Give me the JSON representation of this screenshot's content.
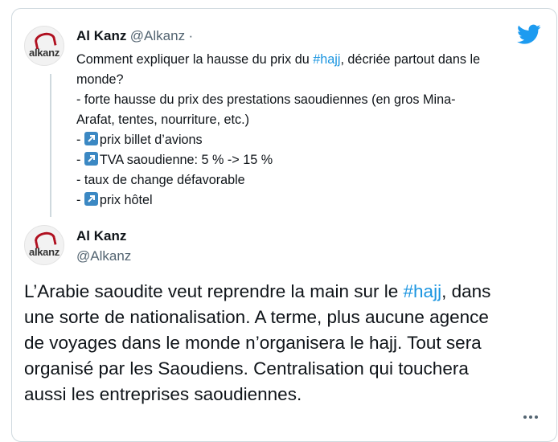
{
  "tweet1": {
    "author_name": "Al Kanz",
    "author_handle": "@Alkanz",
    "separator": "·",
    "avatar_text": "alkanz",
    "line1_pre": "Comment expliquer la hausse du prix du ",
    "hashtag": "#hajj",
    "line1_post": ", décriée partout dans le",
    "line2": "monde?",
    "line3": "- forte hausse du prix des prestations saoudiennes (en gros Mina-",
    "line4": "Arafat, tentes, nourriture, etc.)",
    "dash": "-",
    "item_flight": "prix billet d’avions",
    "item_vat": "TVA saoudienne: 5 % -> 15 %",
    "item_exchange": "- taux de change défavorable",
    "item_hotel": "prix hôtel"
  },
  "tweet2": {
    "author_name": "Al Kanz",
    "author_handle": "@Alkanz",
    "avatar_text": "alkanz",
    "line1_pre": "L’Arabie saoudite veut reprendre la main sur le ",
    "hashtag": "#hajj",
    "line1_post": ", dans",
    "line2": "une sorte de nationalisation. A terme, plus aucune agence",
    "line3": "de voyages dans le monde n’organisera le hajj. Tout sera",
    "line4": "organisé par les Saoudiens. Centralisation qui touchera",
    "line5": "aussi les entreprises saoudiennes."
  },
  "colors": {
    "link": "#1b95e0",
    "twitter_blue": "#1d9bf0",
    "emoji_box": "#3b88c3",
    "border": "#cfd9de",
    "muted": "#536471"
  },
  "icons": {
    "brand": "twitter-bird-icon",
    "emoji": "up-right-arrow-icon",
    "menu": "more-dots-icon"
  }
}
